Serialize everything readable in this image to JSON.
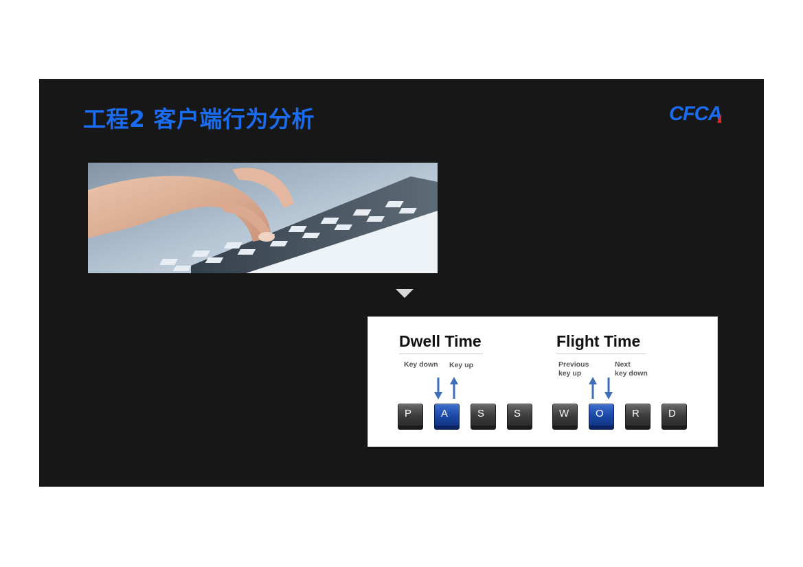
{
  "slide": {
    "title": "工程2 客户端行为分析",
    "logo": {
      "prefix": "CFC",
      "suffix": "A",
      "color": "#1a6cf0",
      "accent": "#e0262b"
    }
  },
  "photo": {
    "icon": "keyboard-typing-photo"
  },
  "diagram": {
    "dwell": {
      "heading": "Dwell Time",
      "key_down": "Key down",
      "key_up": "Key up"
    },
    "flight": {
      "heading": "Flight Time",
      "previous_line1": "Previous",
      "previous_line2": "key up",
      "next_line1": "Next",
      "next_line2": "key down"
    },
    "keys": [
      {
        "label": "P",
        "highlight": false
      },
      {
        "label": "A",
        "highlight": true
      },
      {
        "label": "S",
        "highlight": false
      },
      {
        "label": "S",
        "highlight": false
      },
      {
        "label": "W",
        "highlight": false
      },
      {
        "label": "O",
        "highlight": true
      },
      {
        "label": "R",
        "highlight": false
      },
      {
        "label": "D",
        "highlight": false
      }
    ],
    "arrow_color": "#3e6fb8"
  }
}
